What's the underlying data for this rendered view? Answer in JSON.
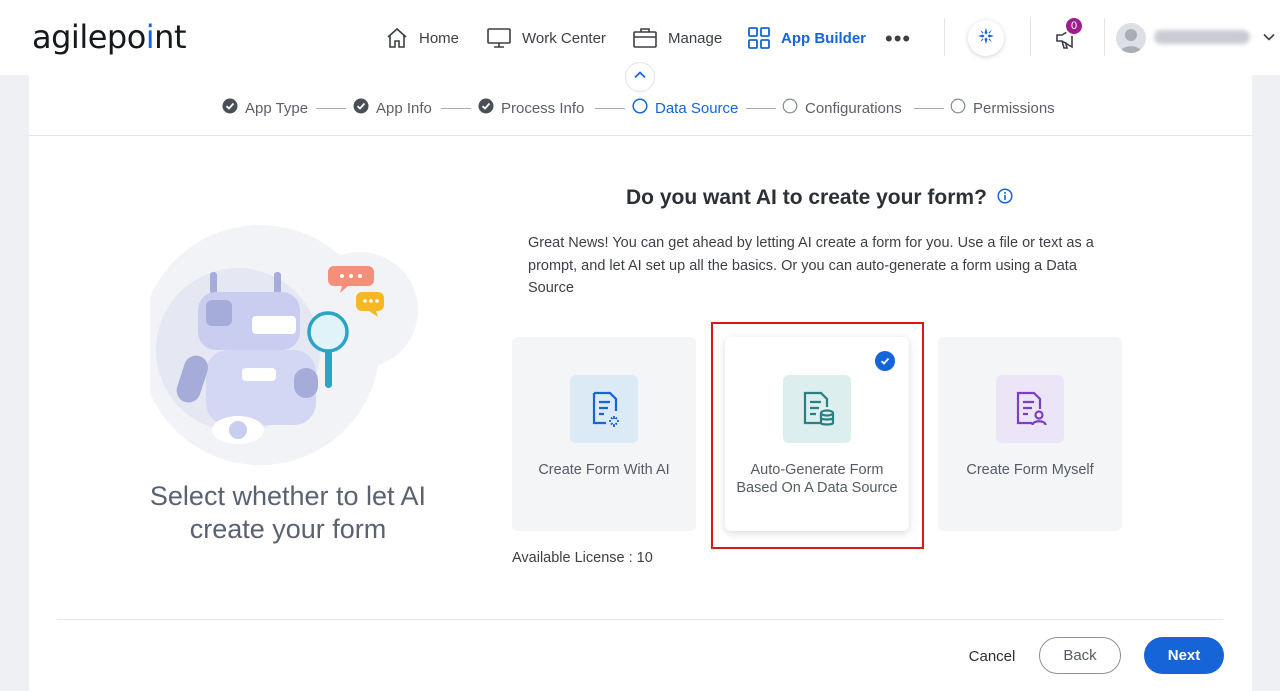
{
  "logo": {
    "text_before": "agilepo",
    "text_after": "nt"
  },
  "nav": {
    "items": [
      {
        "label": "Home",
        "icon": "home-icon"
      },
      {
        "label": "Work Center",
        "icon": "monitor-icon"
      },
      {
        "label": "Manage",
        "icon": "briefcase-icon"
      },
      {
        "label": "App Builder",
        "icon": "grid-icon",
        "active": true
      }
    ],
    "more": "•••",
    "notification_count": "0"
  },
  "stepper": {
    "steps": [
      {
        "label": "App Type",
        "state": "done"
      },
      {
        "label": "App Info",
        "state": "done"
      },
      {
        "label": "Process Info",
        "state": "done"
      },
      {
        "label": "Data Source",
        "state": "current"
      },
      {
        "label": "Configurations",
        "state": "pending"
      },
      {
        "label": "Permissions",
        "state": "pending"
      }
    ]
  },
  "left_panel": {
    "caption": "Select whether to let AI create your form",
    "illustration": "robot-with-magnifier-icon"
  },
  "main": {
    "question": "Do you want AI to create your form?",
    "intro": "Great News! You can get ahead by letting AI create a form for you. Use a file or text as a prompt, and let AI set up all the basics. Or you can auto-generate a form using a Data Source",
    "options": [
      {
        "label": "Create Form With AI",
        "icon": "ai-form-icon",
        "selected": false
      },
      {
        "label": "Auto-Generate Form Based On A Data Source",
        "icon": "database-form-icon",
        "selected": true
      },
      {
        "label": "Create Form Myself",
        "icon": "user-form-icon",
        "selected": false
      }
    ],
    "license": "Available License : 10"
  },
  "footer": {
    "cancel": "Cancel",
    "back": "Back",
    "next": "Next"
  },
  "colors": {
    "primary": "#1565d8",
    "highlight": "#d7191c",
    "badge": "#9c1f8b"
  }
}
